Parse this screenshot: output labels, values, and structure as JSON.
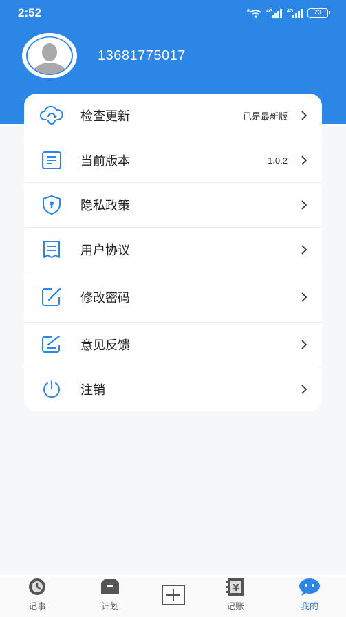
{
  "status_bar": {
    "time": "2:52",
    "signal_1_label": "4G",
    "signal_2_label": "4G",
    "wifi_label": "6",
    "battery": "73"
  },
  "profile": {
    "phone": "13681775017",
    "avatar_icon": "user-avatar-icon"
  },
  "menu": {
    "items": [
      {
        "label": "检查更新",
        "value": "已是最新版",
        "icon": "cloud-refresh-icon"
      },
      {
        "label": "当前版本",
        "value": "1.0.2",
        "icon": "document-lines-icon"
      },
      {
        "label": "隐私政策",
        "value": "",
        "icon": "shield-lock-icon"
      },
      {
        "label": "用户协议",
        "value": "",
        "icon": "agreement-doc-icon"
      },
      {
        "label": "修改密码",
        "value": "",
        "icon": "edit-square-icon"
      },
      {
        "label": "意见反馈",
        "value": "",
        "icon": "feedback-edit-icon"
      },
      {
        "label": "注销",
        "value": "",
        "icon": "power-icon"
      }
    ]
  },
  "tabbar": {
    "tabs": [
      {
        "label": "记事",
        "icon": "clock-icon",
        "active": false
      },
      {
        "label": "计划",
        "icon": "folder-icon",
        "active": false
      },
      {
        "label": "",
        "icon": "plus-box-icon",
        "active": false
      },
      {
        "label": "记账",
        "icon": "yen-book-icon",
        "active": false
      },
      {
        "label": "我的",
        "icon": "chat-face-icon",
        "active": true
      }
    ]
  },
  "colors": {
    "primary": "#2c86e6",
    "background": "#f6f7f9",
    "card": "#ffffff",
    "text": "#222222",
    "icon_blue": "#2c86e6"
  }
}
